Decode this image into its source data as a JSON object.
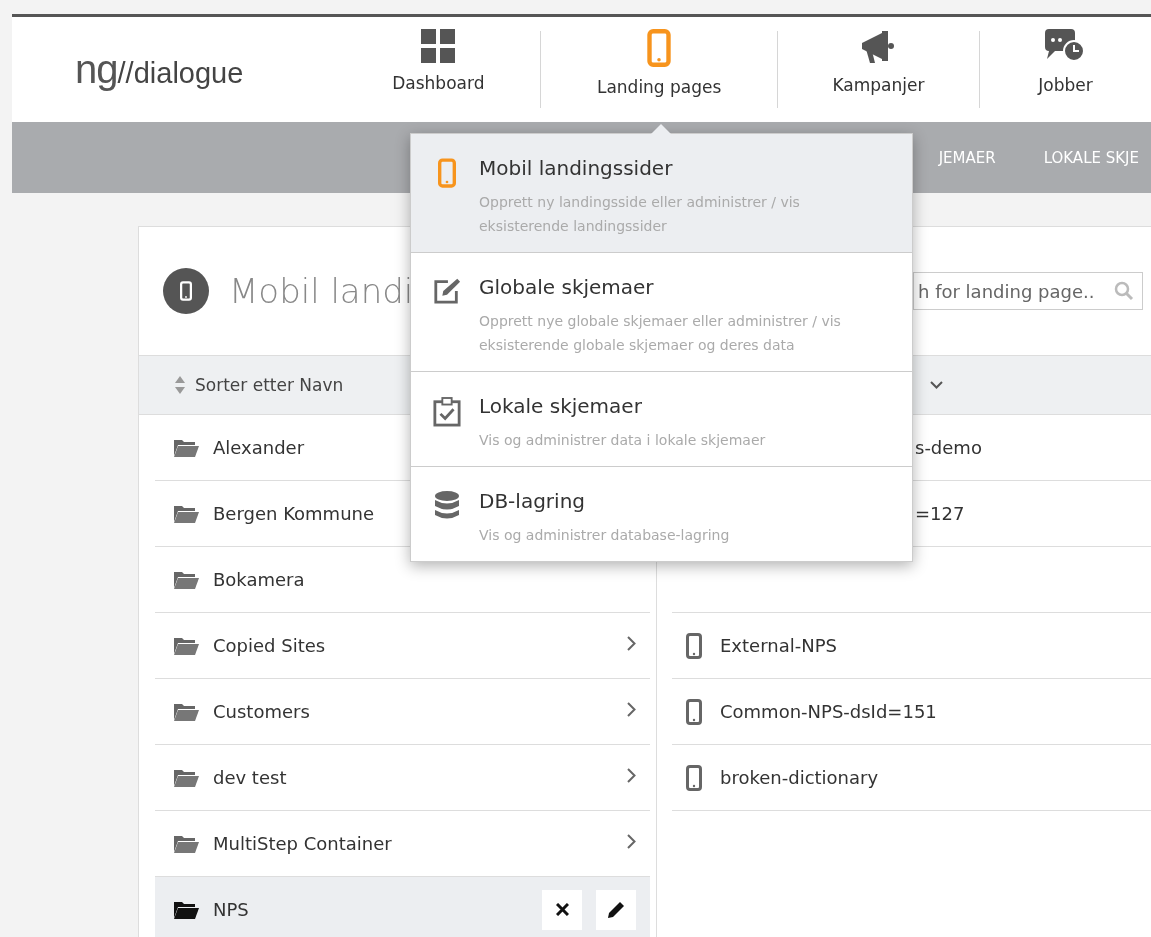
{
  "header": {
    "logo": {
      "mark": "ng",
      "text": "//dialogue"
    },
    "nav": [
      {
        "label": "Dashboard",
        "kind": "grid",
        "selected": false
      },
      {
        "label": "Landing pages",
        "kind": "phone",
        "selected": true
      },
      {
        "label": "Kampanjer",
        "kind": "megaphone",
        "selected": false
      },
      {
        "label": "Jobber",
        "kind": "chat",
        "selected": false
      }
    ]
  },
  "subnav": {
    "items": [
      "JEMAER",
      "LOKALE SKJE"
    ]
  },
  "dropdown": {
    "items": [
      {
        "kind": "phone",
        "title": "Mobil landingssider",
        "description": "Opprett ny landingsside eller administrer / vis eksisterende landingssider",
        "selected": true
      },
      {
        "kind": "edit",
        "title": "Globale skjemaer",
        "description": "Opprett nye globale skjemaer eller administrer / vis eksisterende globale skjemaer og deres data",
        "selected": false
      },
      {
        "kind": "clipboard",
        "title": "Lokale skjemaer",
        "description": "Vis og administrer data i lokale skjemaer",
        "selected": false
      },
      {
        "kind": "database",
        "title": "DB-lagring",
        "description": "Vis og administrer database-lagring",
        "selected": false
      }
    ]
  },
  "panel": {
    "title": "Mobil landi",
    "search": {
      "placeholder": "h for landing page.."
    },
    "sort_label": "Sorter etter Navn",
    "folders": [
      {
        "name": "Alexander",
        "chevron": false,
        "selected": false
      },
      {
        "name": "Bergen Kommune",
        "chevron": false,
        "selected": false
      },
      {
        "name": "Bokamera",
        "chevron": false,
        "selected": false
      },
      {
        "name": "Copied Sites",
        "chevron": true,
        "selected": false
      },
      {
        "name": "Customers",
        "chevron": true,
        "selected": false
      },
      {
        "name": "dev test",
        "chevron": true,
        "selected": false
      },
      {
        "name": "MultiStep Container",
        "chevron": true,
        "selected": false
      },
      {
        "name": "NPS",
        "selected": true
      }
    ],
    "pages": [
      {
        "kind": "partial",
        "name": "s-demo"
      },
      {
        "kind": "partial",
        "name": "=127"
      },
      {
        "kind": "covered"
      },
      {
        "kind": "page",
        "name": "External-NPS"
      },
      {
        "kind": "page",
        "name": "Common-NPS-dsId=151"
      },
      {
        "kind": "page",
        "name": "broken-dictionary"
      }
    ]
  }
}
